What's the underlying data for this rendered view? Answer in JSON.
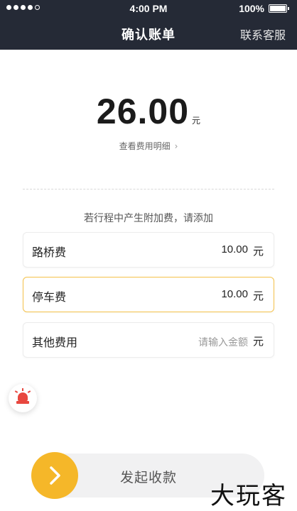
{
  "status_bar": {
    "time": "4:00 PM",
    "battery": "100%"
  },
  "header": {
    "title": "确认账单",
    "contact": "联系客服"
  },
  "summary": {
    "amount": "26.00",
    "unit": "元",
    "detail_link": "查看费用明细"
  },
  "extra_fee_hint": "若行程中产生附加费，请添加",
  "fees": [
    {
      "label": "路桥费",
      "value": "10.00",
      "unit": "元"
    },
    {
      "label": "停车费",
      "value": "10.00",
      "unit": "元"
    },
    {
      "label": "其他费用",
      "placeholder": "请输入金额",
      "unit": "元"
    }
  ],
  "slider": {
    "label": "发起收款"
  },
  "watermark": "大玩客",
  "colors": {
    "header_bg": "#252a36",
    "accent": "#f5b729",
    "active_border": "#f5c24a",
    "alarm": "#e8473f"
  },
  "icons": [
    "signal-icon",
    "battery-icon",
    "chevron-right-icon",
    "alarm-icon",
    "arrow-right-icon"
  ]
}
